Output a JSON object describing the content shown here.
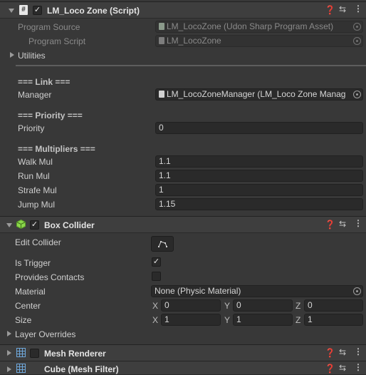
{
  "script_component": {
    "title": "LM_Loco Zone (Script)",
    "enabled_mark": "✓",
    "program_source_label": "Program Source",
    "program_source_value": "LM_LocoZone (Udon Sharp Program Asset)",
    "program_script_label": "Program Script",
    "program_script_value": "LM_LocoZone",
    "utilities_label": "Utilities",
    "link_header": "=== Link ===",
    "manager_label": "Manager",
    "manager_value": "LM_LocoZoneManager (LM_Loco Zone Manag",
    "priority_header": "=== Priority ===",
    "priority_label": "Priority",
    "priority_value": "0",
    "multipliers_header": "=== Multipliers ===",
    "walk_label": "Walk Mul",
    "walk_value": "1.1",
    "run_label": "Run Mul",
    "run_value": "1.1",
    "strafe_label": "Strafe Mul",
    "strafe_value": "1",
    "jump_label": "Jump Mul",
    "jump_value": "1.15"
  },
  "box_collider": {
    "title": "Box Collider",
    "enabled_mark": "✓",
    "edit_collider_label": "Edit Collider",
    "is_trigger_label": "Is Trigger",
    "is_trigger_mark": "✓",
    "provides_contacts_label": "Provides Contacts",
    "material_label": "Material",
    "material_value": "None (Physic Material)",
    "center_label": "Center",
    "center": {
      "x": "0",
      "y": "0",
      "z": "0"
    },
    "size_label": "Size",
    "size": {
      "x": "1",
      "y": "1",
      "z": "1"
    },
    "axis_x": "X",
    "axis_y": "Y",
    "axis_z": "Z",
    "layer_overrides_label": "Layer Overrides"
  },
  "mesh_renderer": {
    "title": "Mesh Renderer"
  },
  "mesh_filter": {
    "title": "Cube (Mesh Filter)"
  },
  "colors": {
    "panel_bg": "#383838",
    "header_bg": "#3e3e3e",
    "field_bg": "#2a2a2a"
  }
}
